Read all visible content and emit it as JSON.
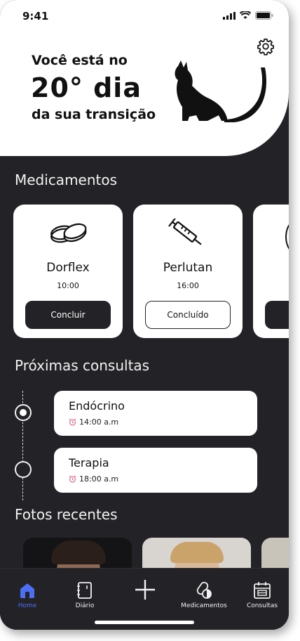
{
  "status_bar": {
    "time": "9:41"
  },
  "hero": {
    "line1": "Você está no",
    "line2": "20° dia",
    "line3": "da sua transição"
  },
  "medications": {
    "title": "Medicamentos",
    "items": [
      {
        "name": "Dorflex",
        "time": "10:00",
        "button": "Concluir",
        "icon": "pills-icon"
      },
      {
        "name": "Perlutan",
        "time": "16:00",
        "button": "Concluído",
        "icon": "syringe-icon"
      }
    ]
  },
  "appointments": {
    "title": "Próximas consultas",
    "items": [
      {
        "name": "Endócrino",
        "time": "14:00 a.m"
      },
      {
        "name": "Terapia",
        "time": "18:00 a.m"
      }
    ]
  },
  "photos": {
    "title": "Fotos recentes"
  },
  "nav": {
    "items": [
      {
        "label": "Home",
        "icon": "home-icon"
      },
      {
        "label": "Diário",
        "icon": "diary-icon"
      },
      {
        "label": "",
        "icon": "plus-icon"
      },
      {
        "label": "Medicamentos",
        "icon": "pills-icon"
      },
      {
        "label": "Consultas",
        "icon": "calendar-icon"
      }
    ]
  },
  "colors": {
    "background": "#232226",
    "surface": "#ffffff",
    "accent": "#4c6ef5"
  }
}
